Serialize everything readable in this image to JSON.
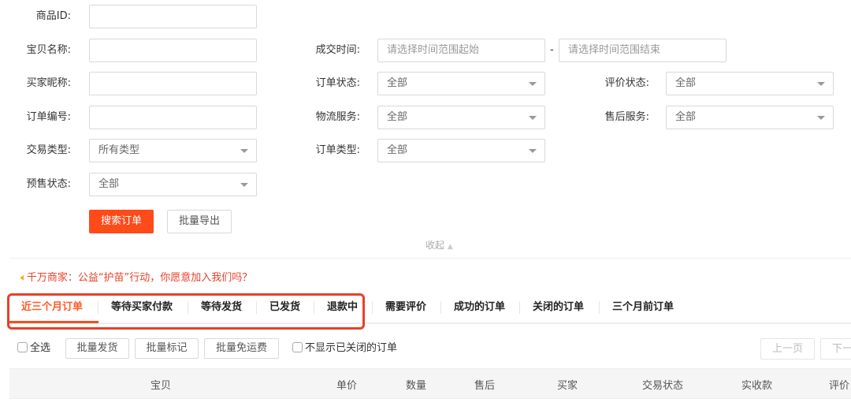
{
  "form": {
    "product_id": {
      "label": "商品ID:",
      "value": ""
    },
    "item_name": {
      "label": "宝贝名称:",
      "value": ""
    },
    "buyer_nick": {
      "label": "买家昵称:",
      "value": ""
    },
    "order_no": {
      "label": "订单编号:",
      "value": ""
    },
    "trade_type": {
      "label": "交易类型:",
      "value": "所有类型"
    },
    "presale_status": {
      "label": "预售状态:",
      "value": "全部"
    },
    "deal_time": {
      "label": "成交时间:",
      "start_placeholder": "请选择时间范围起始",
      "end_placeholder": "请选择时间范围结束",
      "separator": "-"
    },
    "order_status": {
      "label": "订单状态:",
      "value": "全部"
    },
    "logistics": {
      "label": "物流服务:",
      "value": "全部"
    },
    "order_type": {
      "label": "订单类型:",
      "value": "全部"
    },
    "review_status": {
      "label": "评价状态:",
      "value": "全部"
    },
    "after_sale": {
      "label": "售后服务:",
      "value": "全部"
    },
    "search_button": "搜索订单",
    "export_button": "批量导出",
    "collapse": "收起"
  },
  "notice": "千万商家：公益“护苗”行动，你愿意加入我们吗？",
  "tabs": [
    {
      "label": "近三个月订单",
      "active": true
    },
    {
      "label": "等待买家付款"
    },
    {
      "label": "等待发货"
    },
    {
      "label": "已发货"
    },
    {
      "label": "退款中"
    },
    {
      "label": "需要评价"
    },
    {
      "label": "成功的订单"
    },
    {
      "label": "关闭的订单"
    },
    {
      "label": "三个月前订单"
    }
  ],
  "toolbar": {
    "select_all": "全选",
    "batch_ship": "批量发货",
    "batch_mark": "批量标记",
    "batch_free_shipping": "批量免运费",
    "hide_closed": "不显示已关闭的订单",
    "prev_page": "上一页",
    "next_page": "下一页"
  },
  "table": {
    "columns": [
      "宝贝",
      "单价",
      "数量",
      "售后",
      "买家",
      "交易状态",
      "实收款",
      "评价"
    ]
  },
  "colors": {
    "accent": "#ff4a1a",
    "highlight_box": "#e8402a",
    "notice": "#e8402a"
  }
}
